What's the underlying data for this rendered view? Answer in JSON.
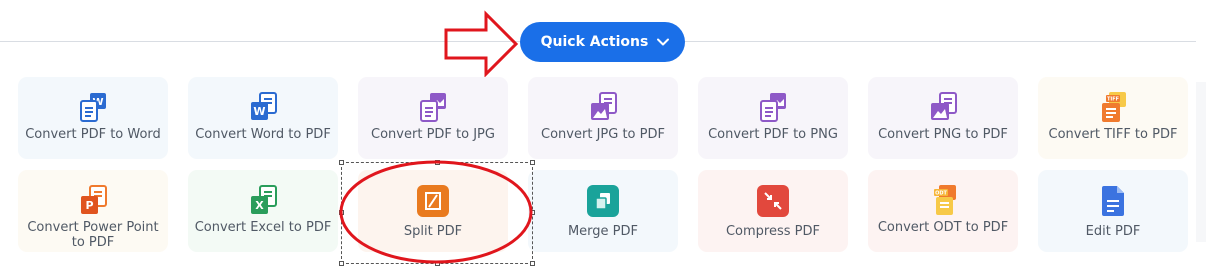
{
  "quick_actions": {
    "label": "Quick Actions"
  },
  "colors": {
    "accent": "#1a6fe8",
    "annotation_red": "#e0161d",
    "word_blue": "#2b6bd1",
    "purple": "#8e59c7",
    "orange": "#f07a2e",
    "excel_green": "#2a9d5b",
    "teal": "#1aa39a",
    "red": "#e2483d"
  },
  "actions": [
    {
      "label": "Convert PDF to Word",
      "icon": "pdf-to-word-icon",
      "bg": "#f3f8fc"
    },
    {
      "label": "Convert Word to PDF",
      "icon": "word-to-pdf-icon",
      "bg": "#f3f8fc"
    },
    {
      "label": "Convert PDF to JPG",
      "icon": "pdf-to-jpg-icon",
      "bg": "#f7f5fa"
    },
    {
      "label": "Convert JPG to PDF",
      "icon": "jpg-to-pdf-icon",
      "bg": "#f7f5fa"
    },
    {
      "label": "Convert PDF to PNG",
      "icon": "pdf-to-png-icon",
      "bg": "#f7f5fa"
    },
    {
      "label": "Convert PNG to PDF",
      "icon": "png-to-pdf-icon",
      "bg": "#f7f5fa"
    },
    {
      "label": "Convert TIFF to PDF",
      "icon": "tiff-to-pdf-icon",
      "bg": "#fdfaf3"
    },
    {
      "label": "Convert Power Point to PDF",
      "icon": "powerpoint-to-pdf-icon",
      "bg": "#fdfaf3"
    },
    {
      "label": "Convert Excel to PDF",
      "icon": "excel-to-pdf-icon",
      "bg": "#f3faf5"
    },
    {
      "label": "Split PDF",
      "icon": "split-pdf-icon",
      "bg": "#fdf4ee"
    },
    {
      "label": "Merge PDF",
      "icon": "merge-pdf-icon",
      "bg": "#f3f8fc"
    },
    {
      "label": "Compress PDF",
      "icon": "compress-pdf-icon",
      "bg": "#fdf3f2"
    },
    {
      "label": "Convert ODT to PDF",
      "icon": "odt-to-pdf-icon",
      "bg": "#fdf3f2"
    },
    {
      "label": "Edit PDF",
      "icon": "edit-pdf-icon",
      "bg": "#f3f8fc"
    }
  ]
}
